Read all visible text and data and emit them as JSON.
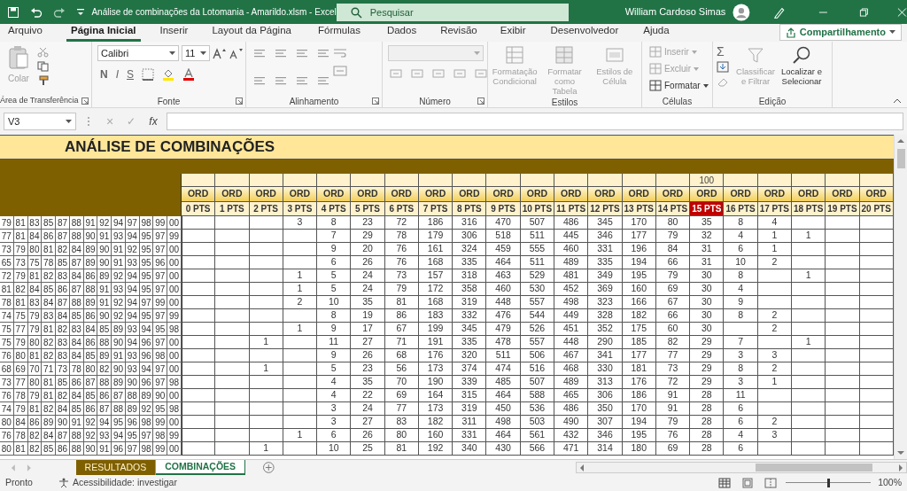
{
  "window": {
    "title": "Análise de combinações da Lotomania - Amarildo.xlsm  -  Excel",
    "search_placeholder": "Pesquisar",
    "user": "William Cardoso Simas"
  },
  "ribbon_tabs": [
    {
      "label": "Arquivo",
      "selected": false
    },
    {
      "label": "Página Inicial",
      "selected": true
    },
    {
      "label": "Inserir",
      "selected": false
    },
    {
      "label": "Layout da Página",
      "selected": false
    },
    {
      "label": "Fórmulas",
      "selected": false
    },
    {
      "label": "Dados",
      "selected": false
    },
    {
      "label": "Revisão",
      "selected": false
    },
    {
      "label": "Exibir",
      "selected": false
    },
    {
      "label": "Desenvolvedor",
      "selected": false
    },
    {
      "label": "Ajuda",
      "selected": false
    }
  ],
  "share_button": "Compartilhamento",
  "ribbon": {
    "clipboard": {
      "label": "Área de Transferência",
      "paste": {
        "label": "Colar",
        "disabled": true
      }
    },
    "font": {
      "label": "Fonte",
      "font_name": "Calibri",
      "font_size": "11",
      "styles": [
        "N",
        "I",
        "S"
      ]
    },
    "alignment": {
      "label": "Alinhamento"
    },
    "number": {
      "label": "Número"
    },
    "styles": {
      "label": "Estilos",
      "buttons": [
        {
          "label": "Formatação Condicional",
          "disabled": true
        },
        {
          "label": "Formatar como Tabela",
          "disabled": true
        },
        {
          "label": "Estilos de Célula",
          "disabled": true
        }
      ]
    },
    "cells": {
      "label": "Células",
      "buttons": [
        {
          "label": "Inserir",
          "disabled": true
        },
        {
          "label": "Excluir",
          "disabled": true
        },
        {
          "label": "Formatar",
          "disabled": false
        }
      ]
    },
    "editing": {
      "label": "Edição",
      "autosum": "Σ",
      "buttons": [
        {
          "label": "Classificar e Filtrar",
          "disabled": true
        },
        {
          "label": "Localizar e Selecionar",
          "disabled": false
        }
      ]
    }
  },
  "formula_bar": {
    "name_box": "V3",
    "cancel": "×",
    "enter": "✓",
    "function": "fx"
  },
  "sheet": {
    "title": "ANÁLISE DE COMBINAÇÕES",
    "columns": [
      {
        "ord": "ORD",
        "label": "0 PTS",
        "highlighted": false
      },
      {
        "ord": "ORD",
        "label": "1 PTS",
        "highlighted": false
      },
      {
        "ord": "ORD",
        "label": "2 PTS",
        "highlighted": false
      },
      {
        "ord": "ORD",
        "label": "3 PTS",
        "highlighted": false
      },
      {
        "ord": "ORD",
        "label": "4 PTS",
        "highlighted": false
      },
      {
        "ord": "ORD",
        "label": "5 PTS",
        "highlighted": false
      },
      {
        "ord": "ORD",
        "label": "6 PTS",
        "highlighted": false
      },
      {
        "ord": "ORD",
        "label": "7 PTS",
        "highlighted": false
      },
      {
        "ord": "ORD",
        "label": "8 PTS",
        "highlighted": false
      },
      {
        "ord": "ORD",
        "label": "9 PTS",
        "highlighted": false
      },
      {
        "ord": "ORD",
        "label": "10 PTS",
        "highlighted": false
      },
      {
        "ord": "ORD",
        "label": "11 PTS",
        "highlighted": false
      },
      {
        "ord": "ORD",
        "label": "12 PTS",
        "highlighted": false
      },
      {
        "ord": "ORD",
        "label": "13 PTS",
        "highlighted": false
      },
      {
        "ord": "ORD",
        "label": "14 PTS",
        "highlighted": false
      },
      {
        "note": "100",
        "ord": "ORD",
        "label": "15 PTS",
        "highlighted": true
      },
      {
        "ord": "ORD",
        "label": "16 PTS",
        "highlighted": false
      },
      {
        "ord": "ORD",
        "label": "17 PTS",
        "highlighted": false
      },
      {
        "ord": "ORD",
        "label": "18 PTS",
        "highlighted": false
      },
      {
        "ord": "ORD",
        "label": "19 PTS",
        "highlighted": false
      },
      {
        "ord": "ORD",
        "label": "20 PTS",
        "highlighted": false
      }
    ],
    "rows": [
      {
        "numbers": [
          "79",
          "81",
          "83",
          "85",
          "87",
          "88",
          "91",
          "92",
          "94",
          "97",
          "98",
          "99",
          "00"
        ],
        "counts": {
          "pts_3": "3",
          "pts_4": "8",
          "pts_5": "23",
          "pts_6": "72",
          "pts_7": "186",
          "pts_8": "316",
          "pts_9": "470",
          "pts_10": "507",
          "pts_11": "486",
          "pts_12": "345",
          "pts_13": "170",
          "pts_14": "80",
          "pts_15": "35",
          "pts_16": "8",
          "pts_17": "4"
        }
      },
      {
        "numbers": [
          "77",
          "81",
          "84",
          "86",
          "87",
          "88",
          "90",
          "91",
          "93",
          "94",
          "95",
          "97",
          "99"
        ],
        "counts": {
          "pts_4": "7",
          "pts_5": "29",
          "pts_6": "78",
          "pts_7": "179",
          "pts_8": "306",
          "pts_9": "518",
          "pts_10": "511",
          "pts_11": "445",
          "pts_12": "346",
          "pts_13": "177",
          "pts_14": "79",
          "pts_15": "32",
          "pts_16": "4",
          "pts_17": "1",
          "pts_18": "1"
        }
      },
      {
        "numbers": [
          "73",
          "79",
          "80",
          "81",
          "82",
          "84",
          "89",
          "90",
          "91",
          "92",
          "95",
          "97",
          "00"
        ],
        "counts": {
          "pts_4": "9",
          "pts_5": "20",
          "pts_6": "76",
          "pts_7": "161",
          "pts_8": "324",
          "pts_9": "459",
          "pts_10": "555",
          "pts_11": "460",
          "pts_12": "331",
          "pts_13": "196",
          "pts_14": "84",
          "pts_15": "31",
          "pts_16": "6",
          "pts_17": "1"
        }
      },
      {
        "numbers": [
          "65",
          "73",
          "75",
          "78",
          "85",
          "87",
          "89",
          "90",
          "91",
          "93",
          "95",
          "96",
          "00"
        ],
        "counts": {
          "pts_4": "6",
          "pts_5": "26",
          "pts_6": "76",
          "pts_7": "168",
          "pts_8": "335",
          "pts_9": "464",
          "pts_10": "511",
          "pts_11": "489",
          "pts_12": "335",
          "pts_13": "194",
          "pts_14": "66",
          "pts_15": "31",
          "pts_16": "10",
          "pts_17": "2"
        }
      },
      {
        "numbers": [
          "72",
          "79",
          "81",
          "82",
          "83",
          "84",
          "86",
          "89",
          "92",
          "94",
          "95",
          "97",
          "00"
        ],
        "counts": {
          "pts_3": "1",
          "pts_4": "5",
          "pts_5": "24",
          "pts_6": "73",
          "pts_7": "157",
          "pts_8": "318",
          "pts_9": "463",
          "pts_10": "529",
          "pts_11": "481",
          "pts_12": "349",
          "pts_13": "195",
          "pts_14": "79",
          "pts_15": "30",
          "pts_16": "8",
          "pts_18": "1"
        }
      },
      {
        "numbers": [
          "81",
          "82",
          "84",
          "85",
          "86",
          "87",
          "88",
          "91",
          "93",
          "94",
          "95",
          "97",
          "00"
        ],
        "counts": {
          "pts_3": "1",
          "pts_4": "5",
          "pts_5": "24",
          "pts_6": "79",
          "pts_7": "172",
          "pts_8": "358",
          "pts_9": "460",
          "pts_10": "530",
          "pts_11": "452",
          "pts_12": "369",
          "pts_13": "160",
          "pts_14": "69",
          "pts_15": "30",
          "pts_16": "4"
        }
      },
      {
        "numbers": [
          "78",
          "81",
          "83",
          "84",
          "87",
          "88",
          "89",
          "91",
          "92",
          "94",
          "97",
          "99",
          "00"
        ],
        "counts": {
          "pts_3": "2",
          "pts_4": "10",
          "pts_5": "35",
          "pts_6": "81",
          "pts_7": "168",
          "pts_8": "319",
          "pts_9": "448",
          "pts_10": "557",
          "pts_11": "498",
          "pts_12": "323",
          "pts_13": "166",
          "pts_14": "67",
          "pts_15": "30",
          "pts_16": "9"
        }
      },
      {
        "numbers": [
          "74",
          "75",
          "79",
          "83",
          "84",
          "85",
          "86",
          "90",
          "92",
          "94",
          "95",
          "97",
          "99"
        ],
        "counts": {
          "pts_4": "8",
          "pts_5": "19",
          "pts_6": "86",
          "pts_7": "183",
          "pts_8": "332",
          "pts_9": "476",
          "pts_10": "544",
          "pts_11": "449",
          "pts_12": "328",
          "pts_13": "182",
          "pts_14": "66",
          "pts_15": "30",
          "pts_16": "8",
          "pts_17": "2"
        }
      },
      {
        "numbers": [
          "75",
          "77",
          "79",
          "81",
          "82",
          "83",
          "84",
          "85",
          "89",
          "93",
          "94",
          "95",
          "98"
        ],
        "counts": {
          "pts_3": "1",
          "pts_4": "9",
          "pts_5": "17",
          "pts_6": "67",
          "pts_7": "199",
          "pts_8": "345",
          "pts_9": "479",
          "pts_10": "526",
          "pts_11": "451",
          "pts_12": "352",
          "pts_13": "175",
          "pts_14": "60",
          "pts_15": "30",
          "pts_17": "2"
        }
      },
      {
        "numbers": [
          "75",
          "79",
          "80",
          "82",
          "83",
          "84",
          "86",
          "88",
          "90",
          "94",
          "96",
          "97",
          "00"
        ],
        "counts": {
          "pts_2": "1",
          "pts_4": "11",
          "pts_5": "27",
          "pts_6": "71",
          "pts_7": "191",
          "pts_8": "335",
          "pts_9": "478",
          "pts_10": "557",
          "pts_11": "448",
          "pts_12": "290",
          "pts_13": "185",
          "pts_14": "82",
          "pts_15": "29",
          "pts_16": "7",
          "pts_18": "1"
        }
      },
      {
        "numbers": [
          "76",
          "80",
          "81",
          "82",
          "83",
          "84",
          "85",
          "89",
          "91",
          "93",
          "96",
          "98",
          "00"
        ],
        "counts": {
          "pts_4": "9",
          "pts_5": "26",
          "pts_6": "68",
          "pts_7": "176",
          "pts_8": "320",
          "pts_9": "511",
          "pts_10": "506",
          "pts_11": "467",
          "pts_12": "341",
          "pts_13": "177",
          "pts_14": "77",
          "pts_15": "29",
          "pts_16": "3",
          "pts_17": "3"
        }
      },
      {
        "numbers": [
          "68",
          "69",
          "70",
          "71",
          "73",
          "78",
          "80",
          "82",
          "90",
          "93",
          "94",
          "97",
          "00"
        ],
        "counts": {
          "pts_2": "1",
          "pts_4": "5",
          "pts_5": "23",
          "pts_6": "56",
          "pts_7": "173",
          "pts_8": "374",
          "pts_9": "474",
          "pts_10": "516",
          "pts_11": "468",
          "pts_12": "330",
          "pts_13": "181",
          "pts_14": "73",
          "pts_15": "29",
          "pts_16": "8",
          "pts_17": "2"
        }
      },
      {
        "numbers": [
          "73",
          "77",
          "80",
          "81",
          "85",
          "86",
          "87",
          "88",
          "89",
          "90",
          "96",
          "97",
          "98"
        ],
        "counts": {
          "pts_4": "4",
          "pts_5": "35",
          "pts_6": "70",
          "pts_7": "190",
          "pts_8": "339",
          "pts_9": "485",
          "pts_10": "507",
          "pts_11": "489",
          "pts_12": "313",
          "pts_13": "176",
          "pts_14": "72",
          "pts_15": "29",
          "pts_16": "3",
          "pts_17": "1"
        }
      },
      {
        "numbers": [
          "76",
          "78",
          "79",
          "81",
          "82",
          "84",
          "85",
          "86",
          "87",
          "88",
          "89",
          "90",
          "00"
        ],
        "counts": {
          "pts_4": "4",
          "pts_5": "22",
          "pts_6": "69",
          "pts_7": "164",
          "pts_8": "315",
          "pts_9": "464",
          "pts_10": "588",
          "pts_11": "465",
          "pts_12": "306",
          "pts_13": "186",
          "pts_14": "91",
          "pts_15": "28",
          "pts_16": "11"
        }
      },
      {
        "numbers": [
          "74",
          "79",
          "81",
          "82",
          "84",
          "85",
          "86",
          "87",
          "88",
          "89",
          "92",
          "95",
          "98"
        ],
        "counts": {
          "pts_4": "3",
          "pts_5": "24",
          "pts_6": "77",
          "pts_7": "173",
          "pts_8": "319",
          "pts_9": "450",
          "pts_10": "536",
          "pts_11": "486",
          "pts_12": "350",
          "pts_13": "170",
          "pts_14": "91",
          "pts_15": "28",
          "pts_16": "6"
        }
      },
      {
        "numbers": [
          "80",
          "84",
          "86",
          "89",
          "90",
          "91",
          "92",
          "94",
          "95",
          "96",
          "98",
          "99",
          "00"
        ],
        "counts": {
          "pts_4": "3",
          "pts_5": "27",
          "pts_6": "83",
          "pts_7": "182",
          "pts_8": "311",
          "pts_9": "498",
          "pts_10": "503",
          "pts_11": "490",
          "pts_12": "307",
          "pts_13": "194",
          "pts_14": "79",
          "pts_15": "28",
          "pts_16": "6",
          "pts_17": "2"
        }
      },
      {
        "numbers": [
          "76",
          "78",
          "82",
          "84",
          "87",
          "88",
          "92",
          "93",
          "94",
          "95",
          "97",
          "98",
          "99"
        ],
        "counts": {
          "pts_3": "1",
          "pts_4": "6",
          "pts_5": "26",
          "pts_6": "80",
          "pts_7": "160",
          "pts_8": "331",
          "pts_9": "464",
          "pts_10": "561",
          "pts_11": "432",
          "pts_12": "346",
          "pts_13": "195",
          "pts_14": "76",
          "pts_15": "28",
          "pts_16": "4",
          "pts_17": "3"
        }
      },
      {
        "numbers": [
          "80",
          "81",
          "82",
          "85",
          "86",
          "88",
          "90",
          "91",
          "96",
          "97",
          "98",
          "99",
          "00"
        ],
        "counts": {
          "pts_2": "1",
          "pts_4": "10",
          "pts_5": "25",
          "pts_6": "81",
          "pts_7": "192",
          "pts_8": "340",
          "pts_9": "430",
          "pts_10": "566",
          "pts_11": "471",
          "pts_12": "314",
          "pts_13": "180",
          "pts_14": "69",
          "pts_15": "28",
          "pts_16": "6"
        }
      }
    ]
  },
  "sheet_tabs": [
    {
      "label": "RESULTADOS",
      "selected": false
    },
    {
      "label": "COMBINAÇÕES",
      "selected": true
    }
  ],
  "status_bar": {
    "state": "Pronto",
    "accessibility": "Acessibilidade: investigar",
    "zoom": "100%",
    "zoom_level": {
      "level": 0.5
    }
  }
}
